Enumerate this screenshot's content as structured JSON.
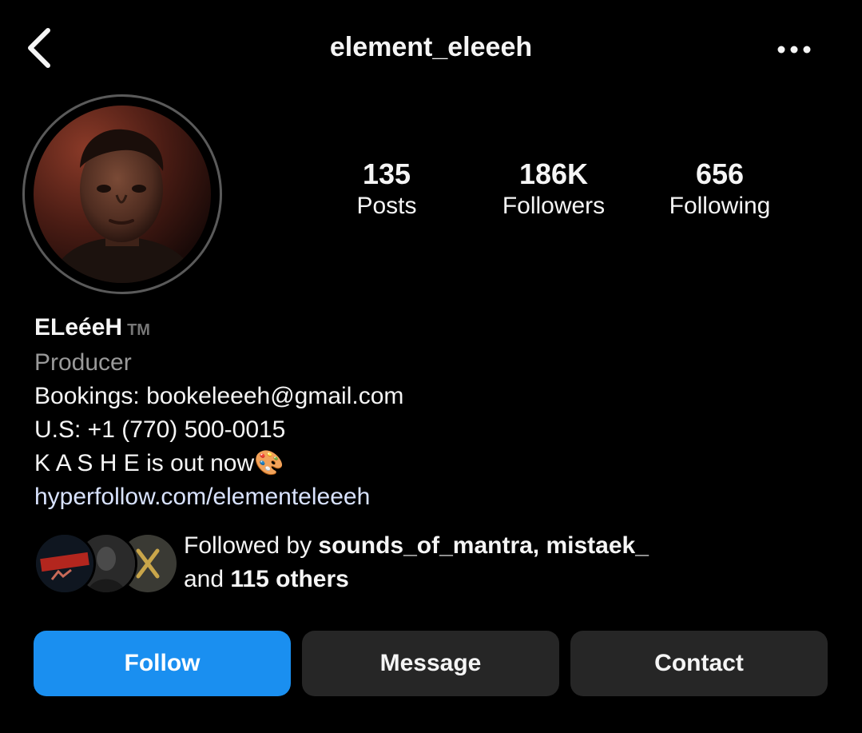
{
  "header": {
    "username": "element_eleeeh",
    "back_icon": "chevron-left-icon",
    "more_icon": "more-horizontal-icon"
  },
  "stats": {
    "posts": {
      "value": "135",
      "label": "Posts"
    },
    "followers": {
      "value": "186K",
      "label": "Followers"
    },
    "following": {
      "value": "656",
      "label": "Following"
    }
  },
  "bio": {
    "display_name": "ELeéeH",
    "tm": "TM",
    "category": "Producer",
    "lines": [
      "Bookings: bookeleeeh@gmail.com",
      "U.S: +1 (770) 500-0015",
      "K A S H E is out now🎨"
    ],
    "link": "hyperfollow.com/elementeleeeh"
  },
  "followed_by": {
    "prefix": "Followed by ",
    "users": "sounds_of_mantra, mistaek_",
    "middle": "and ",
    "others": "115 others"
  },
  "actions": {
    "follow": "Follow",
    "message": "Message",
    "contact": "Contact"
  },
  "colors": {
    "background": "#000000",
    "follow_button": "#1a8ff0",
    "secondary_button": "#262626",
    "muted_text": "#9a9a9a"
  }
}
